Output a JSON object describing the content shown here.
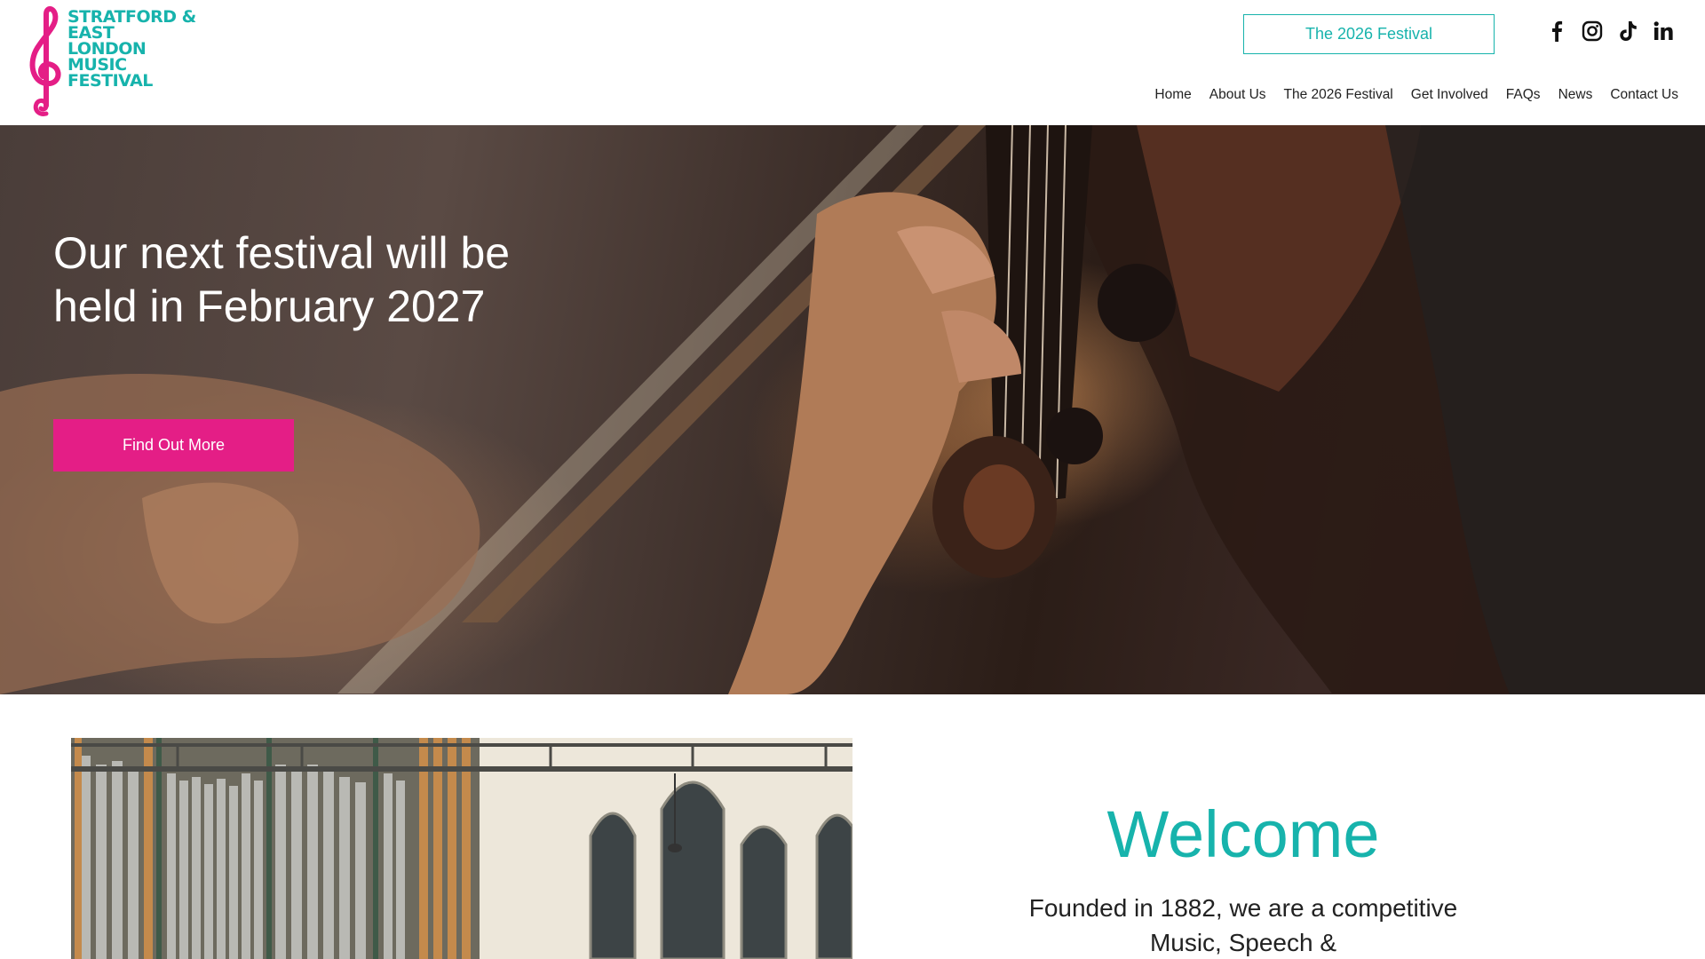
{
  "logo": {
    "lines": [
      "STRATFORD &",
      "EAST",
      "LONDON",
      "MUSIC",
      "FESTIVAL"
    ],
    "text_color": "#17b3ac",
    "clef_color": "#e41e86"
  },
  "header": {
    "cta_label": "The 2026 Festival",
    "social": [
      "facebook-icon",
      "instagram-icon",
      "tiktok-icon",
      "linkedin-icon"
    ],
    "nav": [
      "Home",
      "About Us",
      "The 2026 Festival",
      "Get Involved",
      "FAQs",
      "News",
      "Contact Us"
    ]
  },
  "hero": {
    "title": "Our next festival will be held in February 2027",
    "button_label": "Find Out More",
    "button_color": "#e41e86"
  },
  "welcome": {
    "heading": "Welcome",
    "intro": "Founded in 1882, we are a competitive Music, Speech &",
    "accent": "#17b3ac"
  }
}
